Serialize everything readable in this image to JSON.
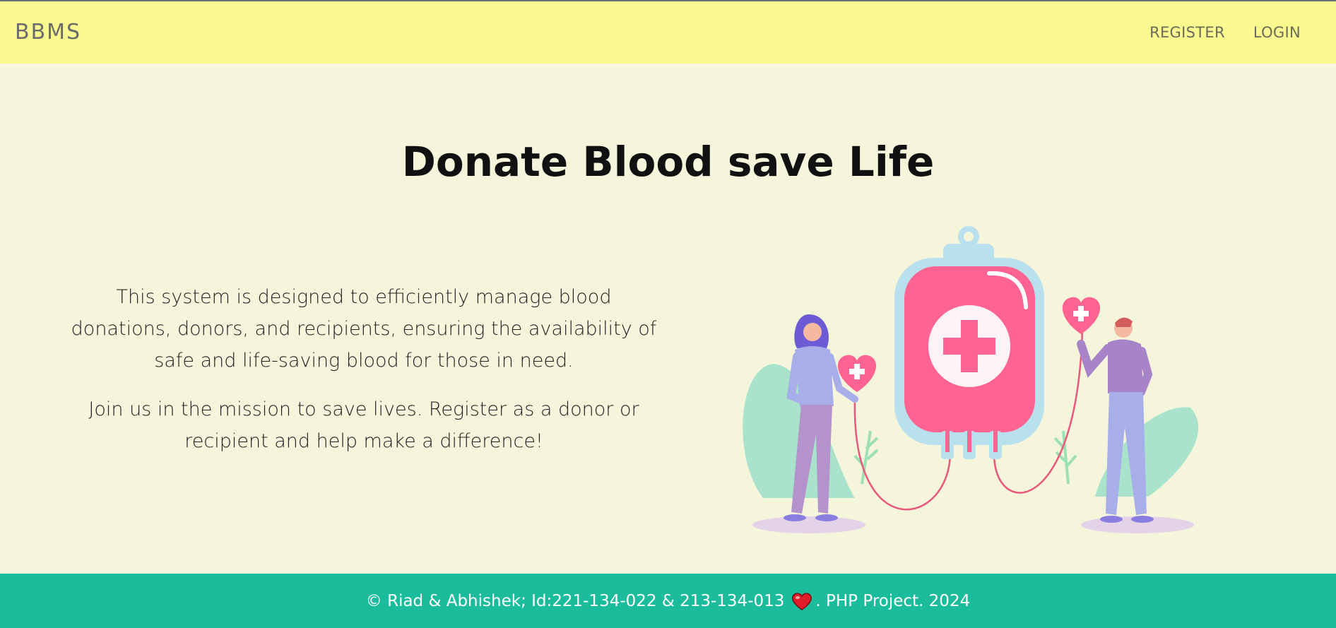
{
  "navbar": {
    "brand": "BBMS",
    "links": [
      {
        "label": "REGISTER"
      },
      {
        "label": "LOGIN"
      }
    ]
  },
  "hero": {
    "title": "Donate Blood save Life",
    "paragraphs": [
      "This system is designed to efficiently manage blood donations, donors, and recipients, ensuring the availability of safe and life-saving blood for those in need.",
      "Join us in the mission to save lives. Register as a donor or recipient and help make a difference!"
    ],
    "illustration_icon": "blood-donation-illustration"
  },
  "footer": {
    "text_before": "© Riad & Abhishek; Id:221-134-022 & 213-134-013",
    "heart_icon": "heart-icon",
    "text_after": ". PHP Project. 2024"
  },
  "colors": {
    "navbar_bg": "#f9f98f",
    "page_bg": "#f5f5dc",
    "footer_bg": "#1abc9c",
    "blood_bag": "#ff6391",
    "heart": "#e11d2a"
  }
}
